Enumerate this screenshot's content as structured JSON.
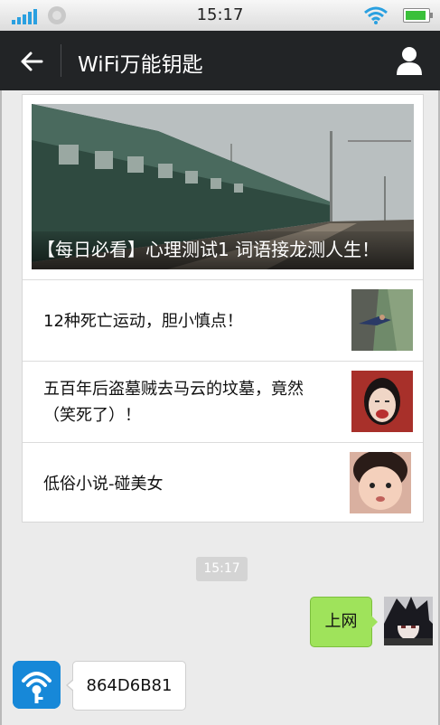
{
  "status_bar": {
    "time": "15:17",
    "signal_icon": "signal-bars-icon",
    "wifi_icon": "wifi-icon",
    "battery_icon": "battery-icon",
    "accent_color": "#2aa0e0"
  },
  "header": {
    "title": "WiFi万能钥匙",
    "back_icon": "back-arrow-icon",
    "profile_icon": "user-profile-icon",
    "background": "#222426"
  },
  "feed": {
    "cover": {
      "title": "【每日必看】心理测试1 词语接龙测人生！",
      "image": "train-photo"
    },
    "items": [
      {
        "title": "12种死亡运动，胆小慎点！",
        "image": "cliff-jump-photo"
      },
      {
        "title": "五百年后盗墓贼去马云的坟墓，竟然（笑死了）！",
        "image": "laughing-woman-photo"
      },
      {
        "title": "低俗小说-碰美女",
        "image": "little-girl-photo"
      }
    ]
  },
  "chat": {
    "timestamp": "15:17",
    "outgoing": {
      "text": "上网",
      "bubble_color": "#9fe35b",
      "avatar": "anime-avatar"
    },
    "incoming": {
      "text": "864D6B81",
      "avatar": "wifi-key-logo-icon",
      "avatar_color": "#1788d8"
    }
  }
}
